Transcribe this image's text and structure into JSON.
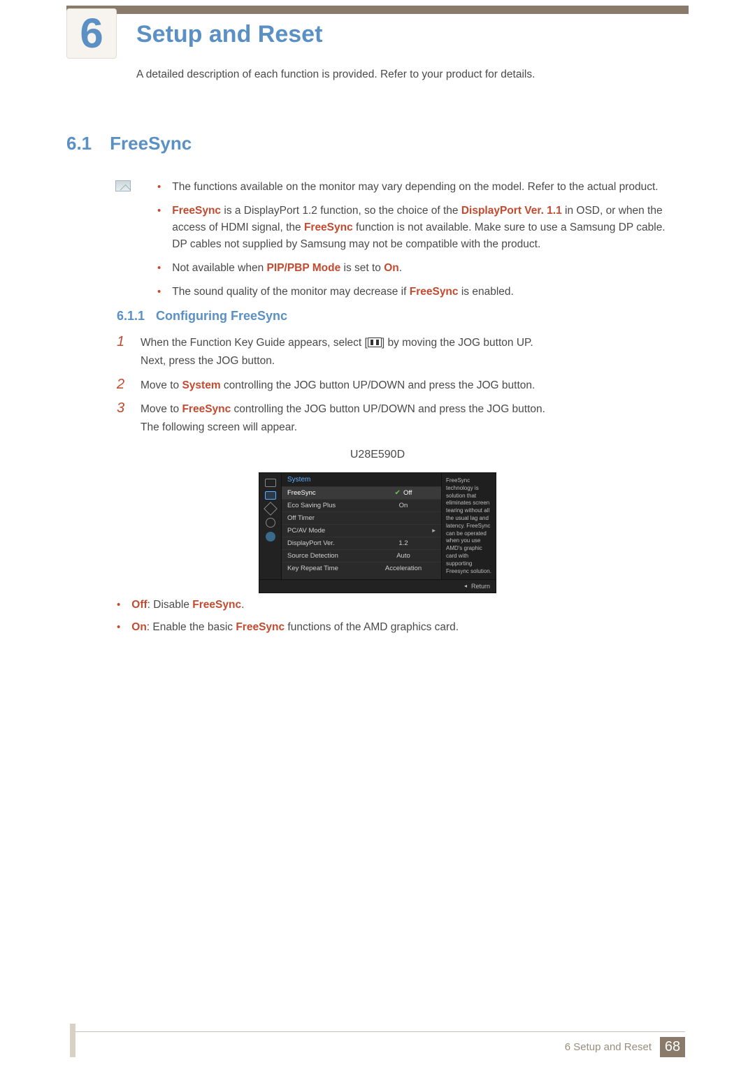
{
  "chapter": {
    "number": "6",
    "title": "Setup and Reset",
    "subtitle": "A detailed description of each function is provided. Refer to your product for details."
  },
  "section": {
    "number": "6.1",
    "title": "FreeSync"
  },
  "notes": {
    "n1": "The functions available on the monitor may vary depending on the model. Refer to the actual product.",
    "n2a": "FreeSync",
    "n2b": " is a DisplayPort 1.2 function, so the choice of the ",
    "n2c": "DisplayPort Ver. 1.1",
    "n2d": " in OSD, or when the access of HDMI signal, the ",
    "n2e": "FreeSync",
    "n2f": " function is not available. Make sure to use a Samsung DP cable. DP cables not supplied by Samsung may not be compatible with the product.",
    "n3a": "Not available when ",
    "n3b": "PIP/PBP Mode",
    "n3c": " is set to ",
    "n3d": "On",
    "n3e": ".",
    "n4a": "The sound quality of the monitor may decrease if ",
    "n4b": "FreeSync",
    "n4c": " is enabled."
  },
  "subsection": {
    "number": "6.1.1",
    "title": "Configuring FreeSync"
  },
  "steps": {
    "s1a": "When the Function Key Guide appears, select [",
    "s1b": "] by moving the JOG button UP.",
    "s1c": "Next, press the JOG button.",
    "s2a": "Move to ",
    "s2b": "System",
    "s2c": " controlling the JOG button UP/DOWN and press the JOG button.",
    "s3a": "Move to ",
    "s3b": "FreeSync",
    "s3c": " controlling the JOG button UP/DOWN and press the JOG button.",
    "s3d": "The following screen will appear.",
    "num1": "1",
    "num2": "2",
    "num3": "3"
  },
  "osd": {
    "caption": "U28E590D",
    "head": "System",
    "rows": {
      "r0": {
        "lab": "FreeSync",
        "val": "Off"
      },
      "r1": {
        "lab": "Eco Saving Plus",
        "val": "On"
      },
      "r2": {
        "lab": "Off Timer",
        "val": ""
      },
      "r3": {
        "lab": "PC/AV Mode",
        "val": ""
      },
      "r4": {
        "lab": "DisplayPort Ver.",
        "val": "1.2"
      },
      "r5": {
        "lab": "Source Detection",
        "val": "Auto"
      },
      "r6": {
        "lab": "Key Repeat Time",
        "val": "Acceleration"
      }
    },
    "side": "FreeSync technology is solution that eliminates screen tearing without all the usual lag and latency. FreeSync can be operated when you use AMD's graphic card with supporting Freesync solution.",
    "return": "Return"
  },
  "options": {
    "o1a": "Off",
    "o1b": ": Disable ",
    "o1c": "FreeSync",
    "o1d": ".",
    "o2a": "On",
    "o2b": ": Enable the basic ",
    "o2c": "FreeSync",
    "o2d": " functions of the AMD graphics card."
  },
  "footer": {
    "label": "6 Setup and Reset",
    "page": "68"
  }
}
